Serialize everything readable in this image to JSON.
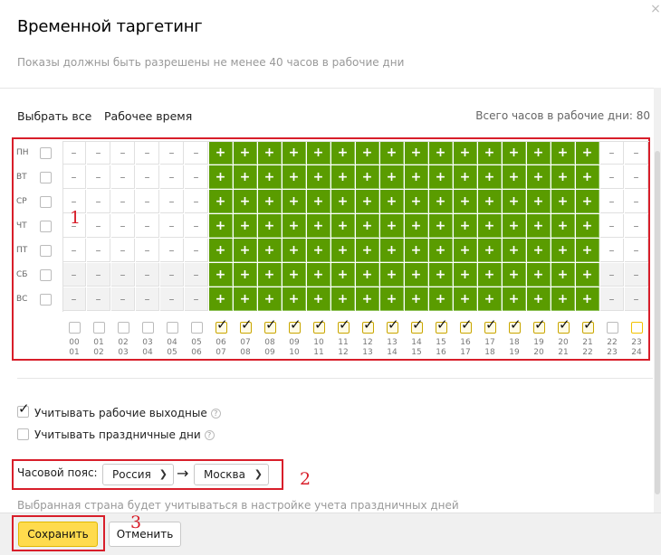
{
  "dialog": {
    "title": "Временной таргетинг",
    "subtitle": "Показы должны быть разрешены не менее 40 часов в рабочие дни",
    "close_icon": "×"
  },
  "toolbar": {
    "select_all": "Выбрать все",
    "work_time": "Рабочее время",
    "total_hours": "Всего часов в рабочие дни: 80"
  },
  "grid": {
    "days": [
      "ПН",
      "ВТ",
      "СР",
      "ЧТ",
      "ПТ",
      "СБ",
      "ВС"
    ],
    "hours_top": [
      "00",
      "01",
      "02",
      "03",
      "04",
      "05",
      "06",
      "07",
      "08",
      "09",
      "10",
      "11",
      "12",
      "13",
      "14",
      "15",
      "16",
      "17",
      "18",
      "19",
      "20",
      "21",
      "22",
      "23"
    ],
    "hours_bottom": [
      "01",
      "02",
      "03",
      "04",
      "05",
      "06",
      "07",
      "08",
      "09",
      "10",
      "11",
      "12",
      "13",
      "14",
      "15",
      "16",
      "17",
      "18",
      "19",
      "20",
      "21",
      "22",
      "23",
      "24"
    ],
    "on_symbol": "+",
    "off_symbol": "–",
    "enabled_hours_from": 6,
    "enabled_hours_to": 22,
    "hour_checks": [
      false,
      false,
      false,
      false,
      false,
      false,
      true,
      true,
      true,
      true,
      true,
      true,
      true,
      true,
      true,
      true,
      true,
      true,
      true,
      true,
      true,
      true,
      false,
      false
    ],
    "highlighted_hour": 23
  },
  "options": {
    "workdays_weekend": {
      "label": "Учитывать рабочие выходные",
      "checked": true,
      "help": "?"
    },
    "holidays": {
      "label": "Учитывать праздничные дни",
      "checked": false,
      "help": "?"
    }
  },
  "timezone": {
    "label": "Часовой пояс:",
    "country": "Россия",
    "arrow": "→",
    "city": "Москва",
    "note": "Выбранная страна будет учитываться в настройке учета праздничных дней"
  },
  "buttons": {
    "save": "Сохранить",
    "cancel": "Отменить"
  },
  "annotations": [
    "1",
    "2",
    "3"
  ],
  "colors": {
    "enabled_cell": "#5a9c00",
    "highlight_box": "#d81e2a",
    "save_button": "#ffdb4d"
  }
}
